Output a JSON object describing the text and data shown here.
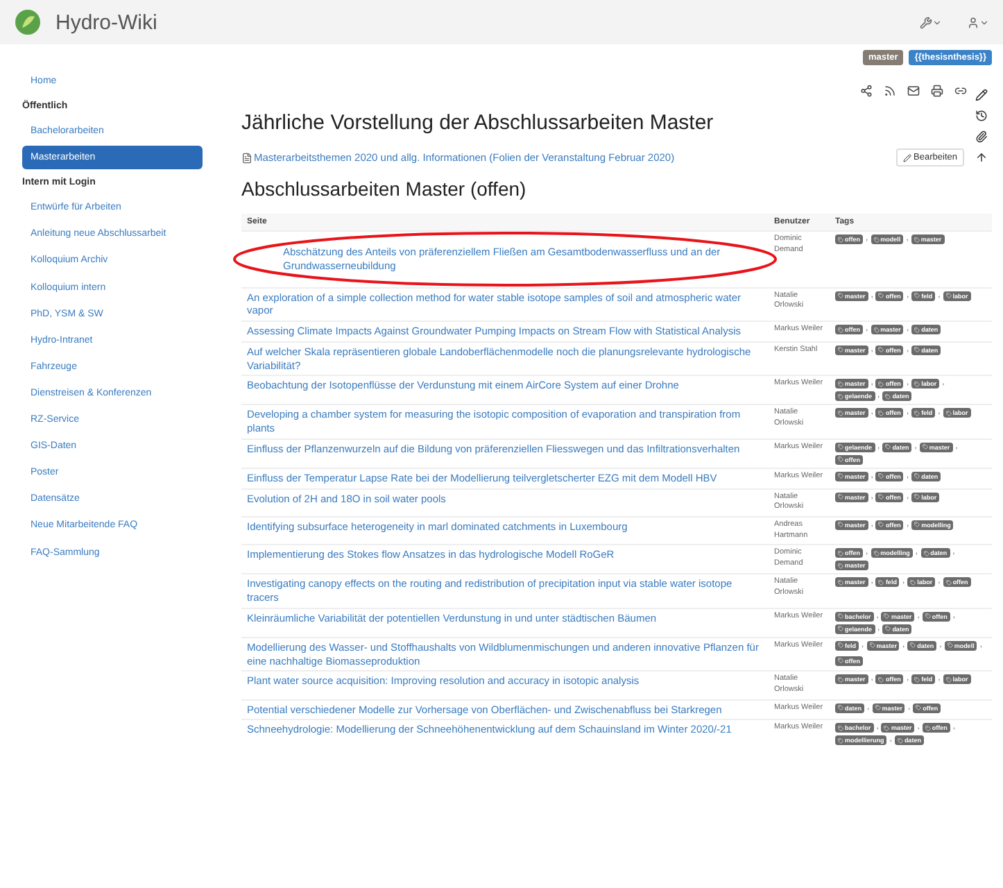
{
  "header": {
    "title": "Hydro-Wiki"
  },
  "sidebar": {
    "items": [
      {
        "kind": "link",
        "label": "Home",
        "selected": false
      },
      {
        "kind": "header",
        "label": "Öffentlich"
      },
      {
        "kind": "link",
        "label": "Bachelorarbeiten",
        "selected": false
      },
      {
        "kind": "link",
        "label": "Masterarbeiten",
        "selected": true
      },
      {
        "kind": "header",
        "label": "Intern mit Login"
      },
      {
        "kind": "link",
        "label": "Entwürfe für Arbeiten",
        "selected": false
      },
      {
        "kind": "link",
        "label": "Anleitung neue Abschlussarbeit",
        "selected": false
      },
      {
        "kind": "link",
        "label": "Kolloquium Archiv",
        "selected": false
      },
      {
        "kind": "link",
        "label": "Kolloquium intern",
        "selected": false
      },
      {
        "kind": "link",
        "label": "PhD, YSM & SW",
        "selected": false
      },
      {
        "kind": "link",
        "label": "Hydro-Intranet",
        "selected": false
      },
      {
        "kind": "link",
        "label": "Fahrzeuge",
        "selected": false
      },
      {
        "kind": "link",
        "label": "Dienstreisen & Konferenzen",
        "selected": false
      },
      {
        "kind": "link",
        "label": "RZ-Service",
        "selected": false
      },
      {
        "kind": "link",
        "label": "GIS-Daten",
        "selected": false
      },
      {
        "kind": "link",
        "label": "Poster",
        "selected": false
      },
      {
        "kind": "link",
        "label": "Datensätze",
        "selected": false
      },
      {
        "kind": "link",
        "label": "Neue Mitarbeitende FAQ",
        "selected": false
      },
      {
        "kind": "link",
        "label": "FAQ-Sammlung",
        "selected": false
      }
    ]
  },
  "page_tags": [
    {
      "kind": "namespace",
      "label": "master"
    },
    {
      "kind": "page",
      "label": "{{thesisnthesis}}"
    }
  ],
  "title": "Jährliche Vorstellung der Abschlussarbeiten Master",
  "attachment_link": "Masterarbeitsthemen 2020 und allg. Informationen (Folien der Veranstaltung Februar 2020)",
  "edit_button": "Bearbeiten",
  "section_title": "Abschlussarbeiten Master (offen)",
  "table": {
    "columns": [
      "Seite",
      "Benutzer",
      "Tags"
    ],
    "separator": ",",
    "rows": [
      {
        "page": "Abschätzung des Anteils von präferenziellem Fließen am Gesamtbodenwasserfluss und an der Grundwasserneubildung",
        "user": "Dominic Demand",
        "tags": [
          "offen",
          "modell",
          "master"
        ],
        "highlighted": true
      },
      {
        "page": "An exploration of a simple collection method for water stable isotope samples of soil and atmospheric water vapor",
        "user": "Natalie Orlowski",
        "tags": [
          "master",
          "offen",
          "feld",
          "labor"
        ],
        "highlighted": false
      },
      {
        "page": "Assessing Climate Impacts Against Groundwater Pumping Impacts on Stream Flow with Statistical Analysis",
        "user": "Markus Weiler",
        "tags": [
          "offen",
          "master",
          "daten"
        ],
        "highlighted": false
      },
      {
        "page": "Auf welcher Skala repräsentieren globale Landoberflächenmodelle noch die planungsrelevante hydrologische Variabilität?",
        "user": "Kerstin Stahl",
        "tags": [
          "master",
          "offen",
          "daten"
        ],
        "highlighted": false
      },
      {
        "page": "Beobachtung der Isotopenflüsse der Verdunstung mit einem AirCore System auf einer Drohne",
        "user": "Markus Weiler",
        "tags": [
          "master",
          "offen",
          "labor",
          "gelaende",
          "daten"
        ],
        "highlighted": false
      },
      {
        "page": "Developing a chamber system for measuring the isotopic composition of evaporation and transpiration from plants",
        "user": "Natalie Orlowski",
        "tags": [
          "master",
          "offen",
          "feld",
          "labor"
        ],
        "highlighted": false
      },
      {
        "page": "Einfluss der Pflanzenwurzeln auf die Bildung von präferenziellen Fliesswegen und das Infiltrationsverhalten",
        "user": "Markus Weiler",
        "tags": [
          "gelaende",
          "daten",
          "master",
          "offen"
        ],
        "highlighted": false
      },
      {
        "page": "Einfluss der Temperatur Lapse Rate bei der Modellierung teilvergletscherter EZG mit dem Modell HBV",
        "user": "Markus Weiler",
        "tags": [
          "master",
          "offen",
          "daten"
        ],
        "highlighted": false
      },
      {
        "page": "Evolution of 2H and 18O in soil water pools",
        "user": "Natalie Orlowski",
        "tags": [
          "master",
          "offen",
          "labor"
        ],
        "highlighted": false
      },
      {
        "page": "Identifying subsurface heterogeneity in marl dominated catchments in Luxembourg",
        "user": "Andreas Hartmann",
        "tags": [
          "master",
          "offen",
          "modelling"
        ],
        "highlighted": false
      },
      {
        "page": "Implementierung des Stokes flow Ansatzes in das hydrologische Modell RoGeR",
        "user": "Dominic Demand",
        "tags": [
          "offen",
          "modelling",
          "daten",
          "master"
        ],
        "highlighted": false
      },
      {
        "page": "Investigating canopy effects on the routing and redistribution of precipitation input via stable water isotope tracers",
        "user": "Natalie Orlowski",
        "tags": [
          "master",
          "feld",
          "labor",
          "offen"
        ],
        "highlighted": false
      },
      {
        "page": "Kleinräumliche Variabilität der potentiellen Verdunstung in und unter städtischen Bäumen",
        "user": "Markus Weiler",
        "tags": [
          "bachelor",
          "master",
          "offen",
          "gelaende",
          "daten"
        ],
        "highlighted": false
      },
      {
        "page": "Modellierung des Wasser- und Stoffhaushalts von Wildblumenmischungen und anderen innovative Pflanzen für eine nachhaltige Biomasseproduktion",
        "user": "Markus Weiler",
        "tags": [
          "feld",
          "master",
          "daten",
          "modell",
          "offen"
        ],
        "highlighted": false
      },
      {
        "page": "Plant water source acquisition: Improving resolution and accuracy in isotopic analysis",
        "user": "Natalie Orlowski",
        "tags": [
          "master",
          "offen",
          "feld",
          "labor"
        ],
        "highlighted": false
      },
      {
        "page": "Potential verschiedener Modelle zur Vorhersage von Oberflächen- und Zwischenabfluss bei Starkregen",
        "user": "Markus Weiler",
        "tags": [
          "daten",
          "master",
          "offen"
        ],
        "highlighted": false
      },
      {
        "page": "Schneehydrologie: Modellierung der Schneehöhenentwicklung auf dem Schauinsland im Winter 2020/-21",
        "user": "Markus Weiler",
        "tags": [
          "bachelor",
          "master",
          "offen",
          "modellierung",
          "daten"
        ],
        "highlighted": false
      }
    ]
  }
}
